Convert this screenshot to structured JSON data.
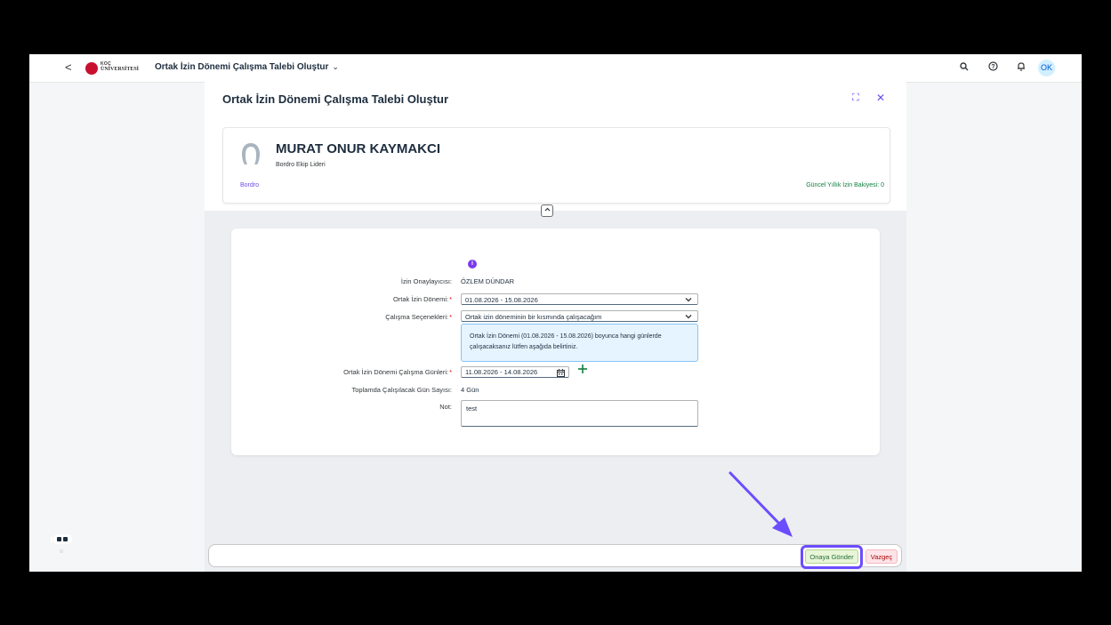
{
  "shell": {
    "back": "<",
    "logo_line1": "KOÇ",
    "logo_line2": "ÜNİVERSİTESİ",
    "title": "Ortak İzin Dönemi Çalışma Talebi Oluştur",
    "title_chevron": "⌄",
    "avatar_initials": "OK",
    "icons": [
      "search-icon",
      "help-icon",
      "bell-icon"
    ]
  },
  "panel": {
    "title": "Ortak İzin Dönemi Çalışma Talebi Oluştur",
    "fullscreen_glyph": "⛶",
    "close_glyph": "✕"
  },
  "profile": {
    "name": "MURAT ONUR KAYMAKCI",
    "role": "Bordro Ekip Lideri",
    "department": "Bordro",
    "balance": "Güncel Yıllık İzin Bakiyesi: 0"
  },
  "form": {
    "info_glyph": "i",
    "approver_label": "İzin Onaylayıcısı:",
    "approver_value": "ÖZLEM DÜNDAR",
    "period_label": "Ortak İzin Dönemi:",
    "period_value": "01.08.2026 - 15.08.2026",
    "option_label": "Çalışma Seçenekleri:",
    "option_value": "Ortak izin döneminin bir kısmında çalışacağım",
    "info_strip": "Ortak İzin Dönemi (01.08.2026 - 15.08.2026) boyunca hangi günlerde çalışacaksanız lütfen aşağıda belirtiniz.",
    "workdays_label": "Ortak İzin Dönemi Çalışma Günleri:",
    "workdays_value": "11.08.2026 - 14.08.2026",
    "total_label": "Toplamda Çalışılacak Gün Sayısı:",
    "total_value": "4 Gün",
    "note_label": "Not:",
    "note_value": "test",
    "required_mark": "*"
  },
  "footer": {
    "submit_label": "Onaya Gönder",
    "cancel_label": "Vazgeç"
  },
  "colors": {
    "accent": "#6c4cff",
    "brand": "#c8102e",
    "success": "#107e3e"
  }
}
